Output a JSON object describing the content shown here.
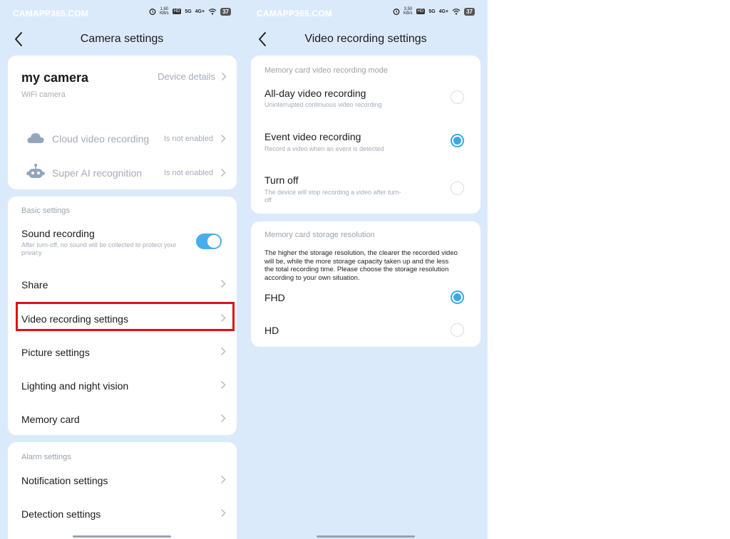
{
  "status_bar": {
    "watermark": "CAMAPP365.COM",
    "left_speed_top": "1.60",
    "left_speed_unit": "KB/s",
    "right_speed_top": "3.50",
    "right_speed_unit": "KB/s",
    "hd_badge": "HD",
    "network_5g": "5G",
    "network_4g": "4G+",
    "battery": "37"
  },
  "left": {
    "title": "Camera settings",
    "device": {
      "name": "my camera",
      "type": "WiFi camera",
      "details_link": "Device details"
    },
    "services": [
      {
        "label": "Cloud video recording",
        "status": "Is not enabled",
        "icon": "cloud-icon"
      },
      {
        "label": "Super AI recognition",
        "status": "Is not enabled",
        "icon": "robot-icon"
      }
    ],
    "basic": {
      "section_title": "Basic settings",
      "sound_recording": {
        "label": "Sound recording",
        "description": "After turn-off, no sound will be collected to protect your privacy",
        "enabled": true
      },
      "items": [
        "Share",
        "Video recording settings",
        "Picture settings",
        "Lighting and night vision",
        "Memory card"
      ]
    },
    "alarm": {
      "section_title": "Alarm settings",
      "items": [
        "Notification settings",
        "Detection settings"
      ]
    }
  },
  "right": {
    "title": "Video recording settings",
    "mode": {
      "section_title": "Memory card video recording mode",
      "options": [
        {
          "label": "All-day video recording",
          "description": "Uninterrupted continuous video recording",
          "selected": false
        },
        {
          "label": "Event video recording",
          "description": "Record a video when an event is detected",
          "selected": true
        },
        {
          "label": "Turn off",
          "description": "The device will stop recording a video after turn-off",
          "selected": false
        }
      ]
    },
    "resolution": {
      "section_title": "Memory card storage resolution",
      "description": "The higher the storage resolution, the clearer the recorded video will be, while the more storage capacity taken up and the less the total recording time. Please choose the storage resolution according to your own situation.",
      "options": [
        {
          "label": "FHD",
          "selected": true
        },
        {
          "label": "HD",
          "selected": false
        }
      ]
    }
  },
  "colors": {
    "background": "#dbeafb",
    "accent": "#39a9e6",
    "highlight": "#e01010"
  }
}
